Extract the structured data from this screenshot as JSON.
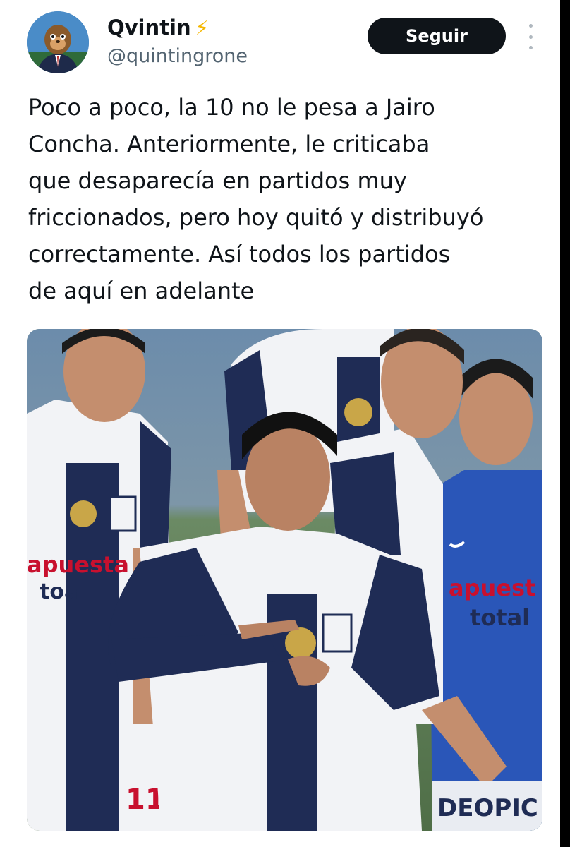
{
  "tweet": {
    "author": {
      "name": "Qvintin",
      "verified_icon": "lightning-bolt-icon",
      "handle": "@quintingrone"
    },
    "follow_label": "Seguir",
    "more_icon": "more-options-icon",
    "text": "Poco a poco, la 10 no le pesa a Jairo\nConcha. Anteriormente, le criticaba\nque desaparecía en partidos muy\nfriccionados, pero hoy quitó y distribuyó\ncorrectamente. Así todos los partidos\nde aquí en adelante"
  },
  "media": {
    "sponsor_left_1": "apuesta",
    "sponsor_left_2": "toal",
    "sponsor_right_1": "apuest",
    "sponsor_right_2": "total",
    "shirt_number": "11",
    "board_text": "DEOPIC",
    "colors": {
      "navy": "#1f2c55",
      "white_kit": "#f2f3f6",
      "blue_kit": "#2a56b8",
      "pitch": "#5f7d55",
      "crowd": "#5d7fa0",
      "sponsor_red": "#c8102e"
    }
  }
}
